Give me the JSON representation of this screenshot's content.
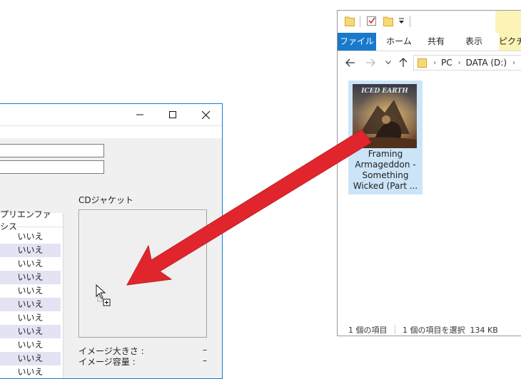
{
  "dialog": {
    "cd_jacket_label": "CDジャケット",
    "column_header": "プリエンファシス",
    "rows": [
      "いいえ",
      "いいえ",
      "いいえ",
      "いいえ",
      "いいえ",
      "いいえ",
      "いいえ",
      "いいえ",
      "いいえ",
      "いいえ",
      "いいえ"
    ],
    "image_size_label": "イメージ大きさ :",
    "image_size_value": "–",
    "image_capacity_label": "イメージ容量 :",
    "image_capacity_value": "–"
  },
  "explorer": {
    "tabs": [
      "ファイル",
      "ホーム",
      "共有",
      "表示",
      "ピクチ"
    ],
    "path": [
      "PC",
      "DATA (D:)"
    ],
    "file_name_lines": [
      "Framing",
      "Armageddon -",
      "Something",
      "Wicked (Part ..."
    ],
    "status_count": "1 個の項目",
    "status_selected": "1 個の項目を選択  134 KB"
  },
  "colors": {
    "accent": "#1979ca",
    "selection": "#cce4f7",
    "arrow": "#e0262c",
    "alt_row": "#e3e3f3"
  },
  "icons": [
    "minimize-icon",
    "maximize-icon",
    "close-icon",
    "folder-icon",
    "checkmark-icon",
    "back-arrow-icon",
    "forward-arrow-icon",
    "up-arrow-icon",
    "drag-copy-cursor-icon"
  ]
}
